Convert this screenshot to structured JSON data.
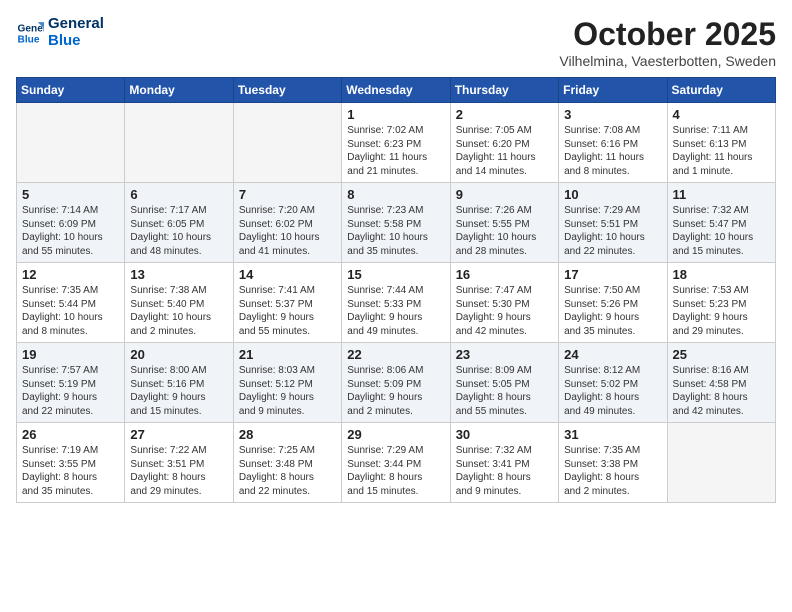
{
  "header": {
    "logo_line1": "General",
    "logo_line2": "Blue",
    "month": "October 2025",
    "location": "Vilhelmina, Vaesterbotten, Sweden"
  },
  "weekdays": [
    "Sunday",
    "Monday",
    "Tuesday",
    "Wednesday",
    "Thursday",
    "Friday",
    "Saturday"
  ],
  "weeks": [
    {
      "shaded": false,
      "days": [
        {
          "num": "",
          "info": ""
        },
        {
          "num": "",
          "info": ""
        },
        {
          "num": "",
          "info": ""
        },
        {
          "num": "1",
          "info": "Sunrise: 7:02 AM\nSunset: 6:23 PM\nDaylight: 11 hours\nand 21 minutes."
        },
        {
          "num": "2",
          "info": "Sunrise: 7:05 AM\nSunset: 6:20 PM\nDaylight: 11 hours\nand 14 minutes."
        },
        {
          "num": "3",
          "info": "Sunrise: 7:08 AM\nSunset: 6:16 PM\nDaylight: 11 hours\nand 8 minutes."
        },
        {
          "num": "4",
          "info": "Sunrise: 7:11 AM\nSunset: 6:13 PM\nDaylight: 11 hours\nand 1 minute."
        }
      ]
    },
    {
      "shaded": true,
      "days": [
        {
          "num": "5",
          "info": "Sunrise: 7:14 AM\nSunset: 6:09 PM\nDaylight: 10 hours\nand 55 minutes."
        },
        {
          "num": "6",
          "info": "Sunrise: 7:17 AM\nSunset: 6:05 PM\nDaylight: 10 hours\nand 48 minutes."
        },
        {
          "num": "7",
          "info": "Sunrise: 7:20 AM\nSunset: 6:02 PM\nDaylight: 10 hours\nand 41 minutes."
        },
        {
          "num": "8",
          "info": "Sunrise: 7:23 AM\nSunset: 5:58 PM\nDaylight: 10 hours\nand 35 minutes."
        },
        {
          "num": "9",
          "info": "Sunrise: 7:26 AM\nSunset: 5:55 PM\nDaylight: 10 hours\nand 28 minutes."
        },
        {
          "num": "10",
          "info": "Sunrise: 7:29 AM\nSunset: 5:51 PM\nDaylight: 10 hours\nand 22 minutes."
        },
        {
          "num": "11",
          "info": "Sunrise: 7:32 AM\nSunset: 5:47 PM\nDaylight: 10 hours\nand 15 minutes."
        }
      ]
    },
    {
      "shaded": false,
      "days": [
        {
          "num": "12",
          "info": "Sunrise: 7:35 AM\nSunset: 5:44 PM\nDaylight: 10 hours\nand 8 minutes."
        },
        {
          "num": "13",
          "info": "Sunrise: 7:38 AM\nSunset: 5:40 PM\nDaylight: 10 hours\nand 2 minutes."
        },
        {
          "num": "14",
          "info": "Sunrise: 7:41 AM\nSunset: 5:37 PM\nDaylight: 9 hours\nand 55 minutes."
        },
        {
          "num": "15",
          "info": "Sunrise: 7:44 AM\nSunset: 5:33 PM\nDaylight: 9 hours\nand 49 minutes."
        },
        {
          "num": "16",
          "info": "Sunrise: 7:47 AM\nSunset: 5:30 PM\nDaylight: 9 hours\nand 42 minutes."
        },
        {
          "num": "17",
          "info": "Sunrise: 7:50 AM\nSunset: 5:26 PM\nDaylight: 9 hours\nand 35 minutes."
        },
        {
          "num": "18",
          "info": "Sunrise: 7:53 AM\nSunset: 5:23 PM\nDaylight: 9 hours\nand 29 minutes."
        }
      ]
    },
    {
      "shaded": true,
      "days": [
        {
          "num": "19",
          "info": "Sunrise: 7:57 AM\nSunset: 5:19 PM\nDaylight: 9 hours\nand 22 minutes."
        },
        {
          "num": "20",
          "info": "Sunrise: 8:00 AM\nSunset: 5:16 PM\nDaylight: 9 hours\nand 15 minutes."
        },
        {
          "num": "21",
          "info": "Sunrise: 8:03 AM\nSunset: 5:12 PM\nDaylight: 9 hours\nand 9 minutes."
        },
        {
          "num": "22",
          "info": "Sunrise: 8:06 AM\nSunset: 5:09 PM\nDaylight: 9 hours\nand 2 minutes."
        },
        {
          "num": "23",
          "info": "Sunrise: 8:09 AM\nSunset: 5:05 PM\nDaylight: 8 hours\nand 55 minutes."
        },
        {
          "num": "24",
          "info": "Sunrise: 8:12 AM\nSunset: 5:02 PM\nDaylight: 8 hours\nand 49 minutes."
        },
        {
          "num": "25",
          "info": "Sunrise: 8:16 AM\nSunset: 4:58 PM\nDaylight: 8 hours\nand 42 minutes."
        }
      ]
    },
    {
      "shaded": false,
      "days": [
        {
          "num": "26",
          "info": "Sunrise: 7:19 AM\nSunset: 3:55 PM\nDaylight: 8 hours\nand 35 minutes."
        },
        {
          "num": "27",
          "info": "Sunrise: 7:22 AM\nSunset: 3:51 PM\nDaylight: 8 hours\nand 29 minutes."
        },
        {
          "num": "28",
          "info": "Sunrise: 7:25 AM\nSunset: 3:48 PM\nDaylight: 8 hours\nand 22 minutes."
        },
        {
          "num": "29",
          "info": "Sunrise: 7:29 AM\nSunset: 3:44 PM\nDaylight: 8 hours\nand 15 minutes."
        },
        {
          "num": "30",
          "info": "Sunrise: 7:32 AM\nSunset: 3:41 PM\nDaylight: 8 hours\nand 9 minutes."
        },
        {
          "num": "31",
          "info": "Sunrise: 7:35 AM\nSunset: 3:38 PM\nDaylight: 8 hours\nand 2 minutes."
        },
        {
          "num": "",
          "info": ""
        }
      ]
    }
  ]
}
